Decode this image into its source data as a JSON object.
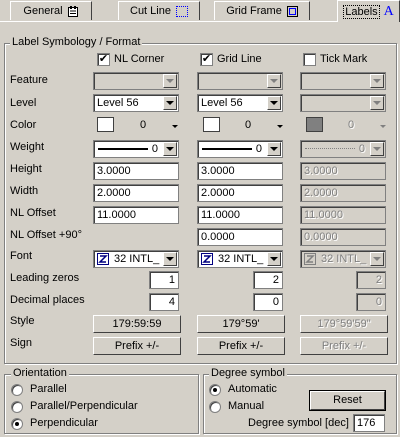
{
  "tabs": [
    {
      "label": "General",
      "icon": "general-icon"
    },
    {
      "label": "Cut Line",
      "icon": "cut-line-icon"
    },
    {
      "label": "Grid Frame",
      "icon": "grid-frame-icon"
    },
    {
      "label": "Labels",
      "icon": "labels-icon",
      "active": true
    }
  ],
  "symbology": {
    "title": "Label Symbology / Format",
    "columns": [
      {
        "label": "NL Corner",
        "checked": true,
        "check_mark": "✔"
      },
      {
        "label": "Grid Line",
        "checked": true,
        "check_mark": "✔"
      },
      {
        "label": "Tick Mark",
        "checked": false,
        "check_mark": ""
      }
    ],
    "rows": {
      "feature": "Feature",
      "level": "Level",
      "color": "Color",
      "weight": "Weight",
      "height": "Height",
      "width": "Width",
      "nl_offset": "NL Offset",
      "nl_offset_90": "NL Offset +90°",
      "font": "Font",
      "leading_zeros": "Leading zeros",
      "decimal_places": "Decimal places",
      "style": "Style",
      "sign": "Sign"
    },
    "values": [
      {
        "level": "Level 56",
        "color": "0",
        "weight": "0",
        "height": "3.0000",
        "width": "2.0000",
        "nl_offset": "11.0000",
        "nl_offset_90": "",
        "font": "32  INTL_",
        "leading_zeros": "1",
        "decimal_places": "4",
        "style": "179:59:59",
        "sign": "Prefix +/-"
      },
      {
        "level": "Level 56",
        "color": "0",
        "weight": "0",
        "height": "3.0000",
        "width": "2.0000",
        "nl_offset": "11.0000",
        "nl_offset_90": "0.0000",
        "font": "32  INTL_",
        "leading_zeros": "2",
        "decimal_places": "0",
        "style": "179°59'",
        "sign": "Prefix +/-"
      },
      {
        "level": "",
        "color": "0",
        "weight": "0",
        "height": "3.0000",
        "width": "2.0000",
        "nl_offset": "11.0000",
        "nl_offset_90": "0.0000",
        "font": "32  INTL_",
        "leading_zeros": "2",
        "decimal_places": "0",
        "style": "179°59'59\"",
        "sign": "Prefix +/-"
      }
    ]
  },
  "orientation": {
    "title": "Orientation",
    "options": [
      {
        "label": "Parallel",
        "selected": false
      },
      {
        "label": "Parallel/Perpendicular",
        "selected": false
      },
      {
        "label": "Perpendicular",
        "selected": true
      }
    ]
  },
  "degree_symbol": {
    "title": "Degree symbol",
    "options": [
      {
        "label": "Automatic",
        "selected": true
      },
      {
        "label": "Manual",
        "selected": false
      }
    ],
    "reset_label": "Reset",
    "dec_label": "Degree symbol [dec]",
    "dec_value": "176"
  },
  "colors": {
    "face": "#d4d0c8",
    "accent_blue": "#0000ff"
  }
}
